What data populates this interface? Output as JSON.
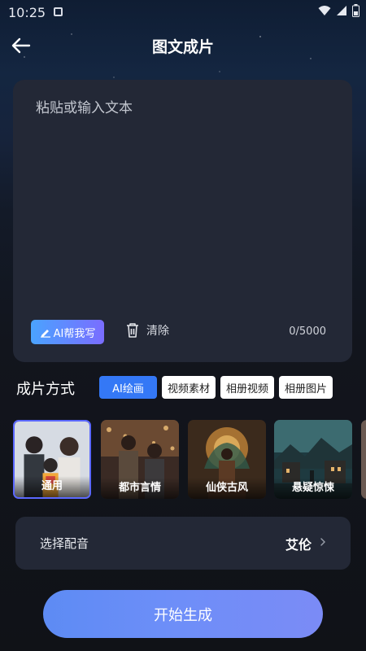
{
  "status": {
    "time": "10:25"
  },
  "header": {
    "title": "图文成片"
  },
  "editor": {
    "placeholder": "粘贴或输入文本",
    "ai_write_label": "AI帮我写",
    "clear_label": "清除",
    "counter": "0/5000"
  },
  "mode": {
    "label": "成片方式",
    "tabs": [
      {
        "label": "AI绘画",
        "active": true
      },
      {
        "label": "视频素材",
        "active": false
      },
      {
        "label": "相册视频",
        "active": false
      },
      {
        "label": "相册图片",
        "active": false
      }
    ]
  },
  "styles": [
    {
      "label": "通用",
      "selected": true
    },
    {
      "label": "都市言情",
      "selected": false
    },
    {
      "label": "仙侠古风",
      "selected": false
    },
    {
      "label": "悬疑惊悚",
      "selected": false
    }
  ],
  "voice": {
    "label": "选择配音",
    "value": "艾伦"
  },
  "start_button": {
    "label": "开始生成"
  },
  "colors": {
    "accent": "#3478f6",
    "card_bg": "#232836",
    "selected_border": "#5b68ff"
  }
}
